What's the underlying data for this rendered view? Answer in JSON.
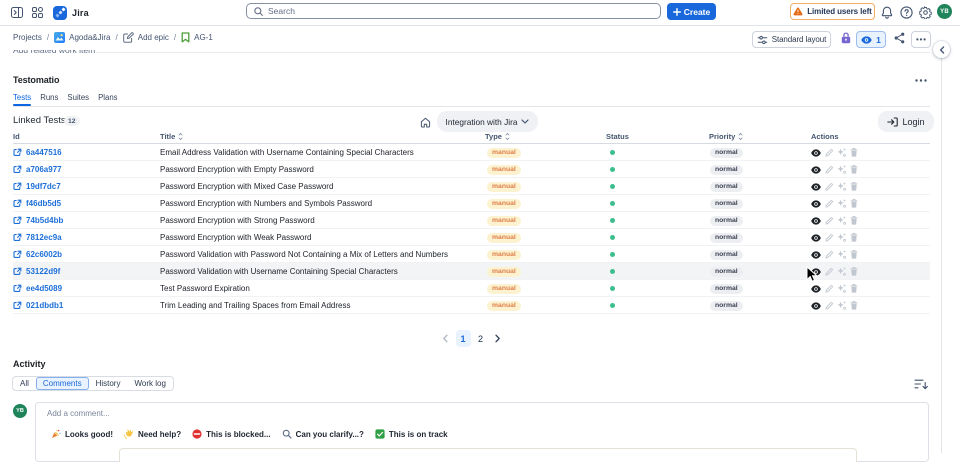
{
  "topnav": {
    "product": "Jira",
    "search_placeholder": "Search",
    "create_label": "Create",
    "limited_users_label": "Limited users left",
    "avatar_initials": "YB"
  },
  "breadcrumb": {
    "items": [
      {
        "label": "Projects",
        "icon": ""
      },
      {
        "label": "Agoda&Jira",
        "icon": "project-avatar-icon"
      },
      {
        "label": "Add epic",
        "icon": "edit-icon"
      },
      {
        "label": "AG-1",
        "icon": "bookmark-icon"
      }
    ]
  },
  "toolbar": {
    "layout_label": "Standard layout",
    "watchers_count": "1"
  },
  "related_work": {
    "label": "Add related work item"
  },
  "panel": {
    "title": "Testomatio",
    "tabs": [
      {
        "label": "Tests",
        "active": true
      },
      {
        "label": "Runs",
        "active": false
      },
      {
        "label": "Suites",
        "active": false
      },
      {
        "label": "Plans",
        "active": false
      }
    ],
    "linked_tests_label": "Linked Tests",
    "linked_tests_count": "12",
    "integration_label": "Integration with Jira",
    "login_label": "Login"
  },
  "table": {
    "columns": [
      {
        "label": "Id",
        "sortable": false
      },
      {
        "label": "Title",
        "sortable": true
      },
      {
        "label": "Type",
        "sortable": true
      },
      {
        "label": "Status",
        "sortable": false
      },
      {
        "label": "Priority",
        "sortable": true
      },
      {
        "label": "Actions",
        "sortable": false
      }
    ],
    "rows": [
      {
        "id": "6a447516",
        "title": "Email Address Validation with Username Containing Special Characters",
        "type": "manual",
        "status": "passed",
        "priority": "normal"
      },
      {
        "id": "a706a977",
        "title": "Password Encryption with Empty Password",
        "type": "manual",
        "status": "passed",
        "priority": "normal"
      },
      {
        "id": "19df7dc7",
        "title": "Password Encryption with Mixed Case Password",
        "type": "manual",
        "status": "passed",
        "priority": "normal"
      },
      {
        "id": "f46db5d5",
        "title": "Password Encryption with Numbers and Symbols Password",
        "type": "manual",
        "status": "passed",
        "priority": "normal"
      },
      {
        "id": "74b5d4bb",
        "title": "Password Encryption with Strong Password",
        "type": "manual",
        "status": "passed",
        "priority": "normal"
      },
      {
        "id": "7812ec9a",
        "title": "Password Encryption with Weak Password",
        "type": "manual",
        "status": "passed",
        "priority": "normal"
      },
      {
        "id": "62c6002b",
        "title": "Password Validation with Password Not Containing a Mix of Letters and Numbers",
        "type": "manual",
        "status": "passed",
        "priority": "normal"
      },
      {
        "id": "53122d9f",
        "title": "Password Validation with Username Containing Special Characters",
        "type": "manual",
        "status": "passed",
        "priority": "normal"
      },
      {
        "id": "ee4d5089",
        "title": "Test Password Expiration",
        "type": "manual",
        "status": "passed",
        "priority": "normal"
      },
      {
        "id": "021dbdb1",
        "title": "Trim Leading and Trailing Spaces from Email Address",
        "type": "manual",
        "status": "passed",
        "priority": "normal"
      }
    ],
    "hovered_row_index": 7
  },
  "pagination": {
    "pages": [
      "1",
      "2"
    ],
    "active_page": "1"
  },
  "activity": {
    "heading": "Activity",
    "filters": [
      {
        "label": "All",
        "active": false
      },
      {
        "label": "Comments",
        "active": true
      },
      {
        "label": "History",
        "active": false
      },
      {
        "label": "Work log",
        "active": false
      }
    ]
  },
  "comment": {
    "avatar_initials": "YB",
    "placeholder": "Add a comment...",
    "quick_replies": [
      {
        "icon": "party-popper-icon",
        "label": "Looks good!"
      },
      {
        "icon": "waving-hand-icon",
        "label": "Need help?"
      },
      {
        "icon": "no-entry-icon",
        "label": "This is blocked..."
      },
      {
        "icon": "magnifier-icon",
        "label": "Can you clarify...?"
      },
      {
        "icon": "check-mark-icon",
        "label": "This is on track"
      }
    ]
  },
  "colors": {
    "brand_blue": "#1868DB",
    "active_tab_blue": "#0C66E4",
    "avatar_green": "#1F845A",
    "status_green": "#3DBE8E",
    "type_badge_bg": "#FCF2CF",
    "type_badge_text": "#DE7E4A",
    "priority_badge_bg": "#EDEEF1",
    "warning_orange": "#E56910",
    "lock_purple": "#6E5DC6"
  }
}
